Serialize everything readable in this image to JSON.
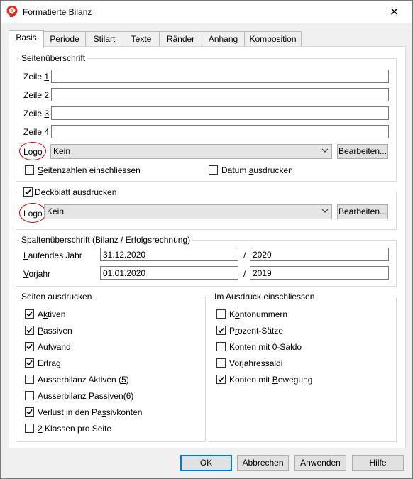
{
  "window": {
    "title": "Formatierte Bilanz",
    "close": "✕"
  },
  "tabs": [
    "Basis",
    "Periode",
    "Stilart",
    "Texte",
    "Ränder",
    "Anhang",
    "Komposition"
  ],
  "header_group": {
    "title": "Seitenüberschrift",
    "rows": [
      {
        "label": "Zeile ",
        "key": "1",
        "value": ""
      },
      {
        "label": "Zeile ",
        "key": "2",
        "value": ""
      },
      {
        "label": "Zeile ",
        "key": "3",
        "value": ""
      },
      {
        "label": "Zeile ",
        "key": "4",
        "value": ""
      }
    ],
    "logo_label": "Logo",
    "logo_value": "Kein",
    "edit_button": "Bearbeiten...",
    "page_numbers": {
      "pre": "",
      "key": "S",
      "post": "eitenzahlen einschliessen",
      "checked": false
    },
    "print_date": {
      "pre": "Datum ",
      "key": "a",
      "post": "usdrucken",
      "checked": false
    }
  },
  "cover_group": {
    "title": "Deckblatt ausdrucken",
    "checked": true,
    "logo_label": "Logo",
    "logo_value": "Kein",
    "edit_button": "Bearbeiten..."
  },
  "column_group": {
    "title": "Spaltenüberschrift (Bilanz / Erfolgsrechnung)",
    "current_year": {
      "pre": "",
      "key": "L",
      "post": "aufendes Jahr",
      "date": "31.12.2020",
      "sep": "/",
      "year": "2020"
    },
    "previous_year": {
      "pre": "",
      "key": "V",
      "post": "orjahr",
      "date": "01.01.2020",
      "sep": "/",
      "year": "2019"
    }
  },
  "pages_group": {
    "title": "Seiten ausdrucken",
    "items": [
      {
        "pre": "A",
        "key": "k",
        "post": "tiven",
        "checked": true
      },
      {
        "pre": "",
        "key": "P",
        "post": "assiven",
        "checked": true
      },
      {
        "pre": "A",
        "key": "u",
        "post": "fwand",
        "checked": true
      },
      {
        "pre": "Ertra",
        "key": "g",
        "post": "",
        "checked": true
      },
      {
        "pre": "Ausserbilanz Aktiven (",
        "key": "5",
        "post": ")",
        "checked": false
      },
      {
        "pre": "Ausserbilanz Passiven(",
        "key": "6",
        "post": ")",
        "checked": false
      },
      {
        "pre": "Verlust in den Pa",
        "key": "s",
        "post": "sivkonten",
        "checked": true
      },
      {
        "pre": "",
        "key": "2",
        "post": " Klassen pro Seite",
        "checked": false
      }
    ]
  },
  "include_group": {
    "title": "Im Ausdruck einschliessen",
    "items": [
      {
        "pre": "K",
        "key": "o",
        "post": "ntonummern",
        "checked": false
      },
      {
        "pre": "P",
        "key": "r",
        "post": "ozent-Sätze",
        "checked": true
      },
      {
        "pre": "Konten mit ",
        "key": "0",
        "post": "-Saldo",
        "checked": false
      },
      {
        "pre": "Vor",
        "key": "j",
        "post": "ahressaldi",
        "checked": false
      },
      {
        "pre": "Konten mit ",
        "key": "B",
        "post": "ewegung",
        "checked": true
      }
    ]
  },
  "footer": {
    "ok": "OK",
    "cancel": "Abbrechen",
    "apply": "Anwenden",
    "help": "Hilfe"
  },
  "colors": {
    "accent": "#0078d7",
    "annotation": "#e00000",
    "app_icon": "#e8281e"
  }
}
